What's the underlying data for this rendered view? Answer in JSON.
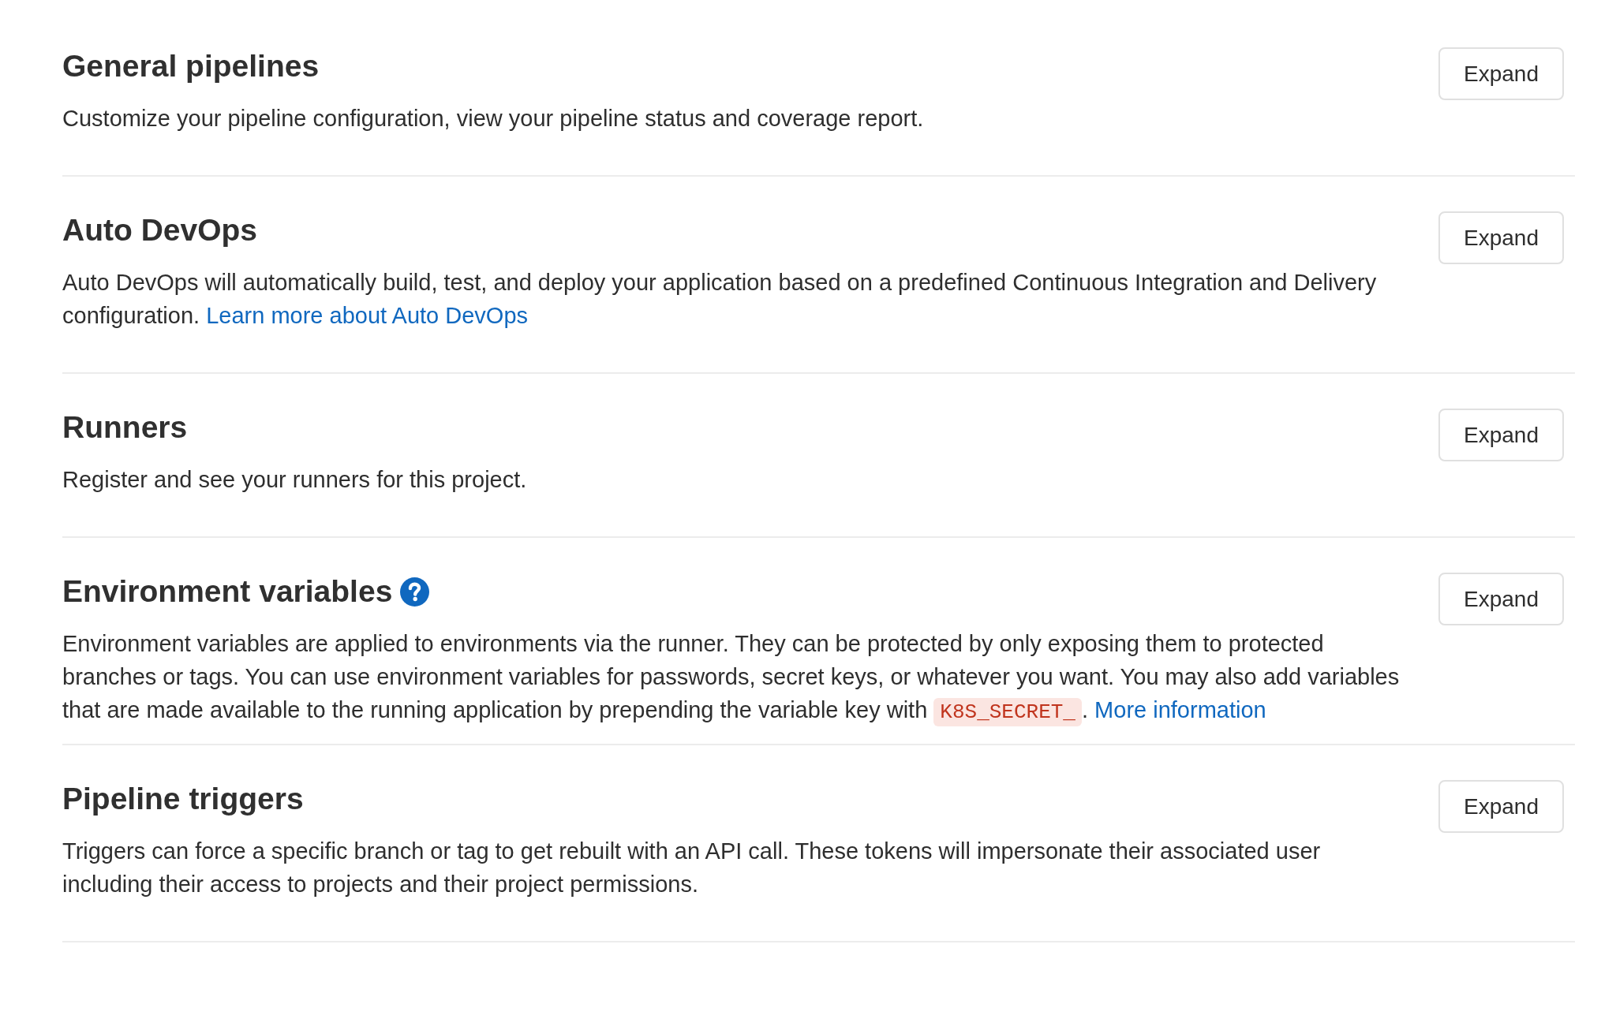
{
  "sections": [
    {
      "title": "General pipelines",
      "help_icon": false,
      "description": [
        {
          "kind": "text",
          "text": "Customize your pipeline configuration, view your pipeline status and coverage report."
        }
      ],
      "button": "Expand"
    },
    {
      "title": "Auto DevOps",
      "help_icon": false,
      "description": [
        {
          "kind": "text",
          "text": "Auto DevOps will automatically build, test, and deploy your application based on a predefined Continuous Integration and Delivery configuration. "
        },
        {
          "kind": "link",
          "text": "Learn more about Auto DevOps"
        }
      ],
      "button": "Expand"
    },
    {
      "title": "Runners",
      "help_icon": false,
      "description": [
        {
          "kind": "text",
          "text": "Register and see your runners for this project."
        }
      ],
      "button": "Expand"
    },
    {
      "title": "Environment variables",
      "help_icon": true,
      "description": [
        {
          "kind": "text",
          "text": "Environment variables are applied to environments via the runner. They can be protected by only exposing them to protected branches or tags. You can use environment variables for passwords, secret keys, or whatever you want. You may also add variables that are made available to the running application by prepending the variable key with "
        },
        {
          "kind": "code",
          "text": "K8S_SECRET_"
        },
        {
          "kind": "text",
          "text": ". "
        },
        {
          "kind": "link",
          "text": "More information"
        }
      ],
      "button": "Expand"
    },
    {
      "title": "Pipeline triggers",
      "help_icon": false,
      "description": [
        {
          "kind": "text",
          "text": "Triggers can force a specific branch or tag to get rebuilt with an API call. These tokens will impersonate their associated user including their access to projects and their project permissions."
        }
      ],
      "button": "Expand"
    }
  ]
}
